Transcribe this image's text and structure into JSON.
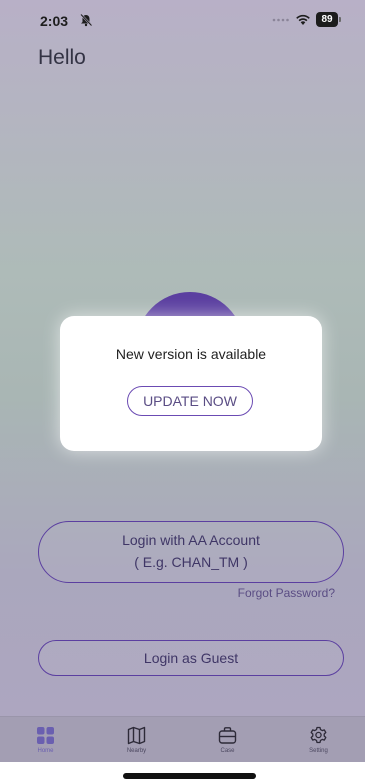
{
  "status_bar": {
    "time": "2:03",
    "battery": "89"
  },
  "header": {
    "greeting": "Hello"
  },
  "dialog": {
    "message": "New version is available",
    "update_label": "UPDATE NOW"
  },
  "login": {
    "aa_line1": "Login with AA Account",
    "aa_line2": "( E.g. CHAN_TM )",
    "forgot_password": "Forgot Password?",
    "guest_label": "Login as Guest"
  },
  "tabs": [
    {
      "label": "Home",
      "icon": "grid-icon"
    },
    {
      "label": "Nearby",
      "icon": "map-icon"
    },
    {
      "label": "Case",
      "icon": "briefcase-icon"
    },
    {
      "label": "Setting",
      "icon": "gear-icon"
    }
  ],
  "colors": {
    "accent": "#5b3fa0",
    "active_tab": "#6a5fb0"
  }
}
